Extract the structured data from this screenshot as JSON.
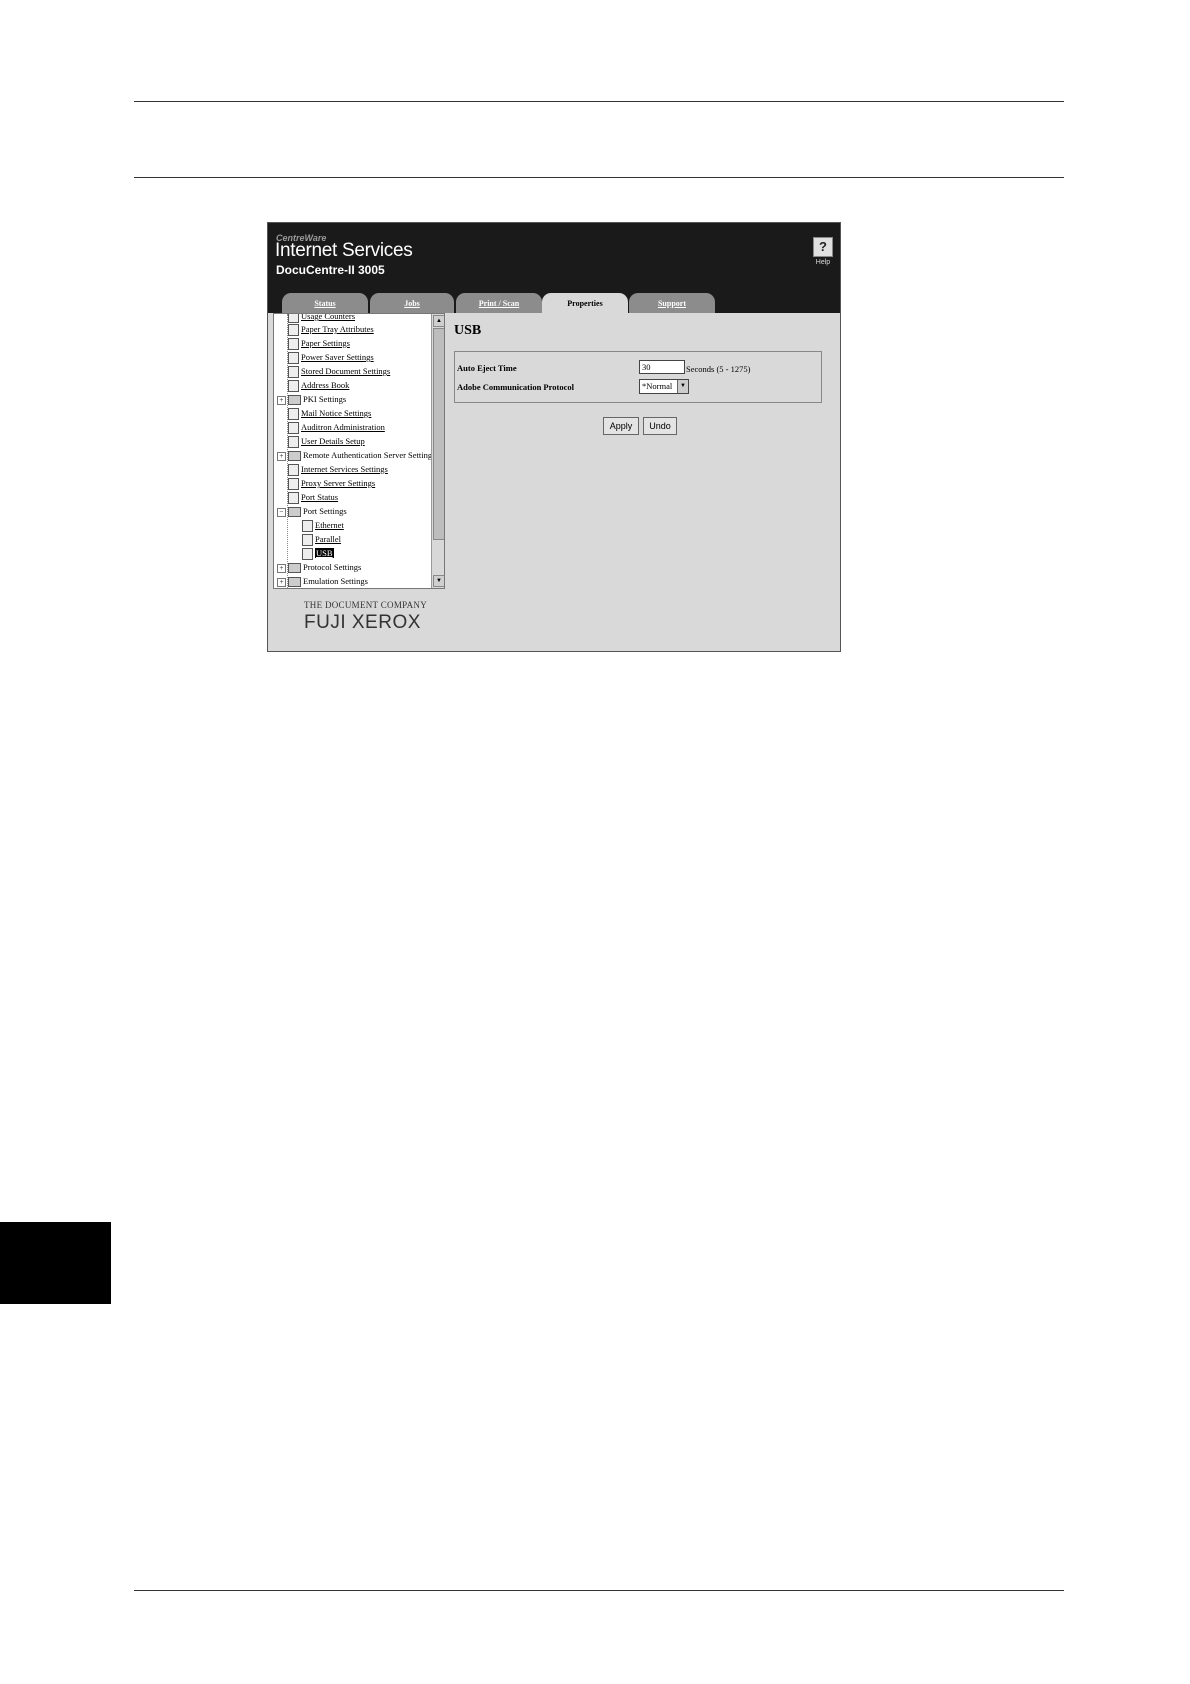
{
  "header": {
    "brand_small": "CentreWare",
    "title": "Internet Services",
    "model": "DocuCentre-II 3005",
    "help_label": "Help"
  },
  "tabs": [
    {
      "label": "Status",
      "active": false
    },
    {
      "label": "Jobs",
      "active": false
    },
    {
      "label": "Print / Scan",
      "active": false
    },
    {
      "label": "Properties",
      "active": true
    },
    {
      "label": "Support",
      "active": false
    }
  ],
  "nav": {
    "items": [
      {
        "label": "Usage Counters"
      },
      {
        "label": "Paper Tray Attributes"
      },
      {
        "label": "Paper Settings"
      },
      {
        "label": "Power Saver Settings"
      },
      {
        "label": "Stored Document Settings"
      },
      {
        "label": "Address Book"
      },
      {
        "label": "PKI Settings"
      },
      {
        "label": "Mail Notice Settings"
      },
      {
        "label": "Auditron Administration"
      },
      {
        "label": "User Details Setup"
      },
      {
        "label": "Remote Authentication Server Settings"
      },
      {
        "label": "Internet Services Settings"
      },
      {
        "label": "Proxy Server Settings"
      },
      {
        "label": "Port Status"
      },
      {
        "label": "Port Settings"
      },
      {
        "label": "Ethernet"
      },
      {
        "label": "Parallel"
      },
      {
        "label": "USB"
      },
      {
        "label": "Protocol Settings"
      },
      {
        "label": "Emulation Settings"
      }
    ]
  },
  "content": {
    "title": "USB",
    "auto_eject_label": "Auto Eject Time",
    "auto_eject_value": "30",
    "auto_eject_unit": "Seconds (5 - 1275)",
    "adobe_label": "Adobe Communication Protocol",
    "adobe_value": "*Normal",
    "apply_label": "Apply",
    "undo_label": "Undo"
  },
  "footer": {
    "company_small": "THE DOCUMENT COMPANY",
    "company_logo": "FUJI XEROX"
  },
  "colors": {
    "header_bg": "#1a1a1a",
    "tab_inactive": "#8c8c8c",
    "panel_bg": "#d9d9d9"
  }
}
